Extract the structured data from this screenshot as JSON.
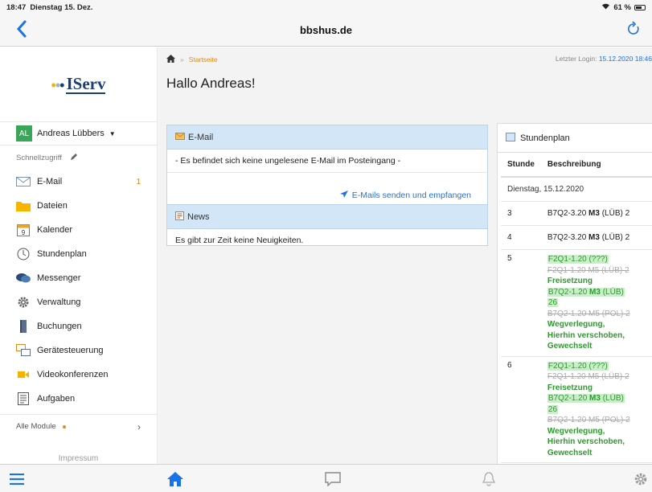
{
  "status": {
    "time": "18:47",
    "date": "Dienstag 15. Dez.",
    "battery": "61 %"
  },
  "nav": {
    "title": "bbshus.de"
  },
  "sidebar": {
    "logo": "IServ",
    "user": {
      "initials": "AL",
      "name": "Andreas Lübbers"
    },
    "quick_access": "Schnellzugriff",
    "items": [
      {
        "label": "E-Mail",
        "icon": "mail-icon",
        "badge": "1"
      },
      {
        "label": "Dateien",
        "icon": "folder-icon"
      },
      {
        "label": "Kalender",
        "icon": "calendar-icon",
        "day": "9"
      },
      {
        "label": "Stundenplan",
        "icon": "clock-icon"
      },
      {
        "label": "Messenger",
        "icon": "chat-icon"
      },
      {
        "label": "Verwaltung",
        "icon": "gear-icon"
      },
      {
        "label": "Buchungen",
        "icon": "book-icon"
      },
      {
        "label": "Gerätesteuerung",
        "icon": "device-icon"
      },
      {
        "label": "Videokonferenzen",
        "icon": "video-icon"
      },
      {
        "label": "Aufgaben",
        "icon": "task-icon"
      }
    ],
    "all_modules": "Alle Module",
    "impressum": "Impressum"
  },
  "main": {
    "breadcrumb": {
      "sep": "»",
      "current": "Startseite"
    },
    "last_login_label": "Letzter Login:",
    "last_login_value": "15.12.2020 18:46",
    "greeting": "Hallo Andreas!",
    "email_panel": {
      "title": "E-Mail",
      "message": "- Es befindet sich keine ungelesene E-Mail im Posteingang -",
      "send_link": "E-Mails senden und empfangen"
    },
    "news_panel": {
      "title": "News",
      "message": "Es gibt zur Zeit keine Neuigkeiten."
    },
    "stundenplan": {
      "title": "Stundenplan",
      "col_stunde": "Stunde",
      "col_beschreibung": "Beschreibung",
      "day": "Dienstag, 15.12.2020",
      "row3": {
        "stunde": "3",
        "pre": "B7Q2-3.20 ",
        "subj": "M3",
        "post": " (LÜB) 2"
      },
      "row4": {
        "stunde": "4",
        "pre": "B7Q2-3.20 ",
        "subj": "M3",
        "post": " (LÜB) 2"
      },
      "row5": {
        "stunde": "5",
        "l1": "F2Q1-1.20 (???)",
        "l2": "F2Q1-1.20 M5 (LÜB) 2",
        "l3": "Freisetzung",
        "l4_pre": "B7Q2-1.20 ",
        "l4_subj": "M3",
        "l4_post": " (LÜB)",
        "l5": "26",
        "l6": "B7Q2-1.20 M5 (POL) 2",
        "l7": "Wegverlegung,",
        "l8": "Hierhin verschoben,",
        "l9": "Gewechselt"
      },
      "row6": {
        "stunde": "6",
        "l1": "F2Q1-1.20 (???)",
        "l2": "F2Q1-1.20 M5 (LÜB) 2",
        "l3": "Freisetzung",
        "l4_pre": "B7Q2-1.20 ",
        "l4_subj": "M3",
        "l4_post": " (LÜB)",
        "l5": "26",
        "l6": "B7Q2-1.20 M5 (POL) 2",
        "l7": "Wegverlegung,",
        "l8": "Hierhin verschoben,",
        "l9": "Gewechselt"
      }
    }
  },
  "tabbar": {
    "icons": [
      "menu-icon",
      "home-icon",
      "chat-icon",
      "bell-icon",
      "gear-icon"
    ]
  },
  "colors": {
    "accent": "#1a73e8",
    "orange": "#e08a1e",
    "panel_header": "#d3e6f8",
    "green": "#2e9a2e"
  }
}
